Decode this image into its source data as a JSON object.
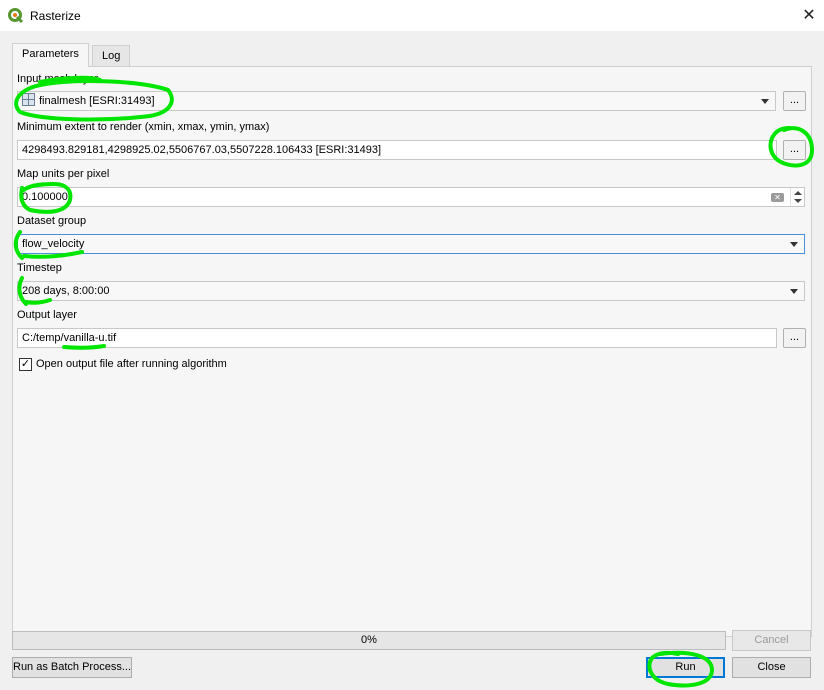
{
  "window": {
    "title": "Rasterize",
    "close_glyph": "✕"
  },
  "tabs": [
    {
      "label": "Parameters",
      "active": true
    },
    {
      "label": "Log",
      "active": false
    }
  ],
  "params": {
    "input_mesh_label": "Input mesh layer",
    "input_mesh_value": "finalmesh [ESRI:31493]",
    "extent_label": "Minimum extent to render (xmin, xmax, ymin, ymax)",
    "extent_value": "4298493.829181,4298925.02,5506767.03,5507228.106433 [ESRI:31493]",
    "map_units_label": "Map units per pixel",
    "map_units_value": "0.100000",
    "dataset_group_label": "Dataset group",
    "dataset_group_value": "flow_velocity",
    "timestep_label": "Timestep",
    "timestep_value": "208 days, 8:00:00",
    "output_layer_label": "Output layer",
    "output_layer_value": "C:/temp/vanilla-u.tif",
    "browse_label": "...",
    "open_output_label": "Open output file after running algorithm",
    "open_output_checked": true,
    "checkmark": "✓"
  },
  "footer": {
    "progress_text": "0%",
    "progress_value": 0,
    "cancel_label": "Cancel",
    "batch_label": "Run as Batch Process...",
    "run_label": "Run",
    "close_label": "Close"
  },
  "colors": {
    "highlight": "#00e600",
    "focus": "#4a90d9",
    "qgis_green": "#589632"
  }
}
